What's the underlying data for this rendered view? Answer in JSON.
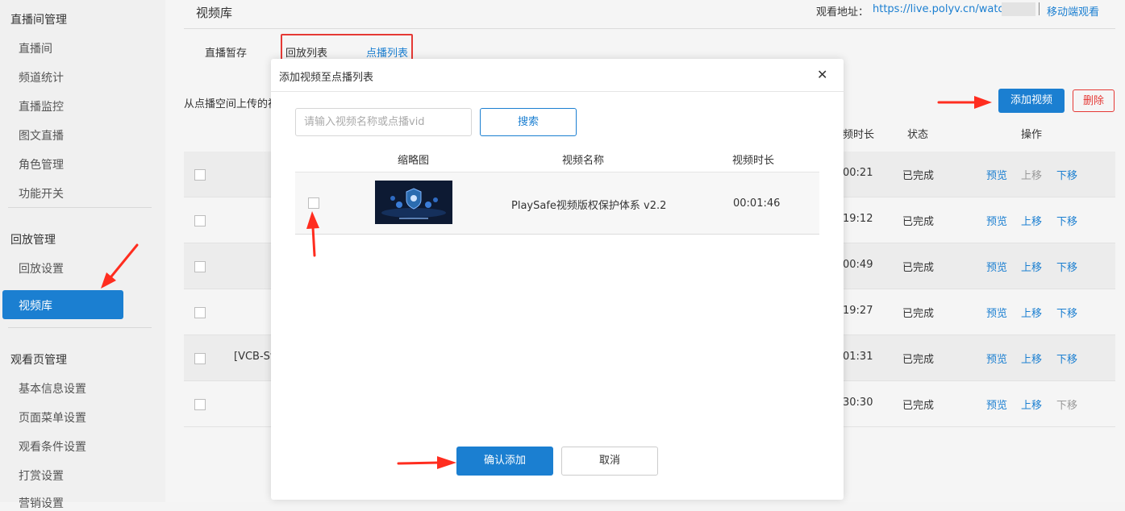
{
  "sidebar": {
    "group_live": "直播间管理",
    "live_items": [
      "直播间",
      "频道统计",
      "直播监控",
      "图文直播",
      "角色管理",
      "功能开关"
    ],
    "group_playback": "回放管理",
    "playback_items": [
      "回放设置",
      "视频库"
    ],
    "group_watch": "观看页管理",
    "watch_items": [
      "基本信息设置",
      "页面菜单设置",
      "观看条件设置",
      "打赏设置",
      "营销设置"
    ]
  },
  "header": {
    "title": "视频库",
    "watch_label": "观看地址：",
    "watch_url": "https://live.polyv.cn/watch/",
    "mobile_link": "移动端观看"
  },
  "tabs": [
    "直播暂存",
    "回放列表",
    "点播列表"
  ],
  "description": "从点播空间上传的视",
  "toolbar": {
    "add_label": "添加视频",
    "delete_label": "删除"
  },
  "table": {
    "headers": {
      "duration": "频时长",
      "status": "状态",
      "ops": "操作"
    },
    "rows": [
      {
        "name": "",
        "duration": "00:21",
        "status": "已完成",
        "ops": [
          "预览",
          "上移",
          "下移"
        ],
        "disabled": [
          false,
          true,
          false
        ]
      },
      {
        "name": "",
        "duration": "19:12",
        "status": "已完成",
        "ops": [
          "预览",
          "上移",
          "下移"
        ],
        "disabled": [
          false,
          false,
          false
        ]
      },
      {
        "name": "",
        "duration": "00:49",
        "status": "已完成",
        "ops": [
          "预览",
          "上移",
          "下移"
        ],
        "disabled": [
          false,
          false,
          false
        ]
      },
      {
        "name": "",
        "duration": "19:27",
        "status": "已完成",
        "ops": [
          "预览",
          "上移",
          "下移"
        ],
        "disabled": [
          false,
          false,
          false
        ]
      },
      {
        "name": "[VCB-Stu",
        "duration": "01:31",
        "status": "已完成",
        "ops": [
          "预览",
          "上移",
          "下移"
        ],
        "disabled": [
          false,
          false,
          false
        ]
      },
      {
        "name": "",
        "duration": "30:30",
        "status": "已完成",
        "ops": [
          "预览",
          "上移",
          "下移"
        ],
        "disabled": [
          false,
          false,
          true
        ]
      }
    ]
  },
  "modal": {
    "title": "添加视频至点播列表",
    "search_placeholder": "请输入视频名称或点播vid",
    "search_button": "搜索",
    "columns": [
      "缩略图",
      "视频名称",
      "视频时长"
    ],
    "video": {
      "name": "PlaySafe视频版权保护体系 v2.2",
      "duration": "00:01:46"
    },
    "confirm": "确认添加",
    "cancel": "取消"
  },
  "colors": {
    "accent": "#1b7fd1",
    "danger": "#e53935"
  }
}
